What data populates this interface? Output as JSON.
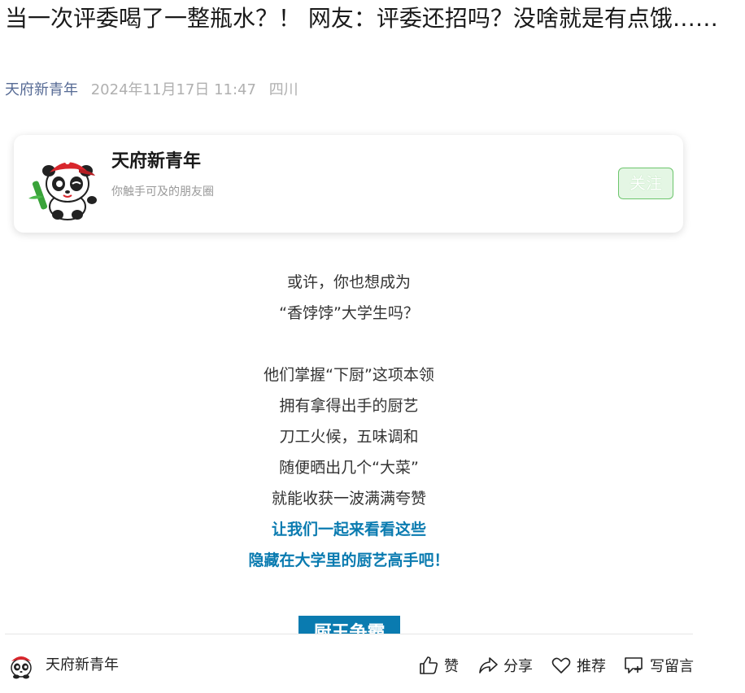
{
  "article": {
    "title": "当一次评委喝了一整瓶水？！ 网友：评委还招吗？没啥就是有点饿……",
    "author": "天府新青年",
    "date": "2024年11月17日 11:47",
    "location": "四川"
  },
  "account_card": {
    "name": "天府新青年",
    "slogan": "你触手可及的朋友圈",
    "follow_label": "关注",
    "avatar_icon": "panda-mascot-icon"
  },
  "body_lines": [
    {
      "text": "或许，你也想成为",
      "style": "normal"
    },
    {
      "text": "“香饽饽”大学生吗？",
      "style": "normal"
    },
    {
      "text": "",
      "style": "blank"
    },
    {
      "text": "他们掌握“下厨”这项本领",
      "style": "normal"
    },
    {
      "text": "拥有拿得出手的厨艺",
      "style": "normal"
    },
    {
      "text": "刀工火候，五味调和",
      "style": "normal"
    },
    {
      "text": "随便晒出几个“大菜”",
      "style": "normal"
    },
    {
      "text": "就能收获一波满满夸赞",
      "style": "normal"
    },
    {
      "text": "让我们一起来看看这些",
      "style": "blue"
    },
    {
      "text": "隐藏在大学里的厨艺高手吧！",
      "style": "blue"
    }
  ],
  "section_heading": {
    "text": "厨王争霸",
    "color": "#0a7bb0"
  },
  "bottom_bar": {
    "account_name": "天府新青年",
    "like_label": "赞",
    "share_label": "分享",
    "recommend_label": "推荐",
    "comment_label": "写留言"
  },
  "colors": {
    "link_blue": "#576b95",
    "accent_blue": "#0a7bb0",
    "follow_green": "#6cc56c"
  }
}
